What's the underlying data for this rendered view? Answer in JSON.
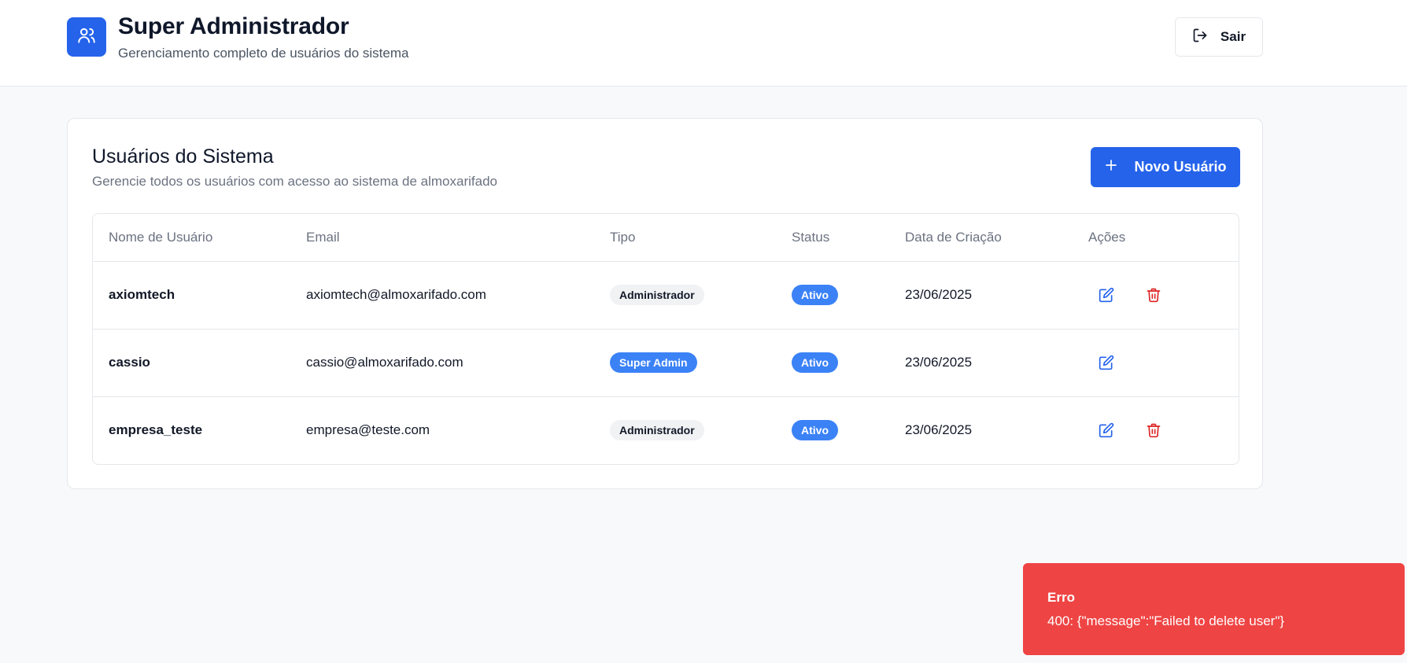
{
  "header": {
    "title": "Super Administrador",
    "subtitle": "Gerenciamento completo de usuários do sistema",
    "logo_icon": "users-icon",
    "logout_label": "Sair",
    "logout_icon": "log-out-icon"
  },
  "card": {
    "title": "Usuários do Sistema",
    "description": "Gerencie todos os usuários com acesso ao sistema de almoxarifado",
    "new_user_label": "Novo Usuário",
    "new_user_icon": "plus-icon"
  },
  "table": {
    "columns": [
      "Nome de Usuário",
      "Email",
      "Tipo",
      "Status",
      "Data de Criação",
      "Ações"
    ],
    "rows": [
      {
        "username": "axiomtech",
        "email": "axiomtech@almoxarifado.com",
        "type": "Administrador",
        "status": "Ativo",
        "created": "23/06/2025",
        "can_delete": true
      },
      {
        "username": "cassio",
        "email": "cassio@almoxarifado.com",
        "type": "Super Admin",
        "status": "Ativo",
        "created": "23/06/2025",
        "can_delete": false
      },
      {
        "username": "empresa_teste",
        "email": "empresa@teste.com",
        "type": "Administrador",
        "status": "Ativo",
        "created": "23/06/2025",
        "can_delete": true
      }
    ]
  },
  "toast": {
    "title": "Erro",
    "message": "400: {\"message\":\"Failed to delete user\"}"
  },
  "colors": {
    "primary": "#2563eb",
    "badge_blue": "#3b82f6",
    "danger": "#ef4444",
    "delete_icon": "#dc2626"
  }
}
